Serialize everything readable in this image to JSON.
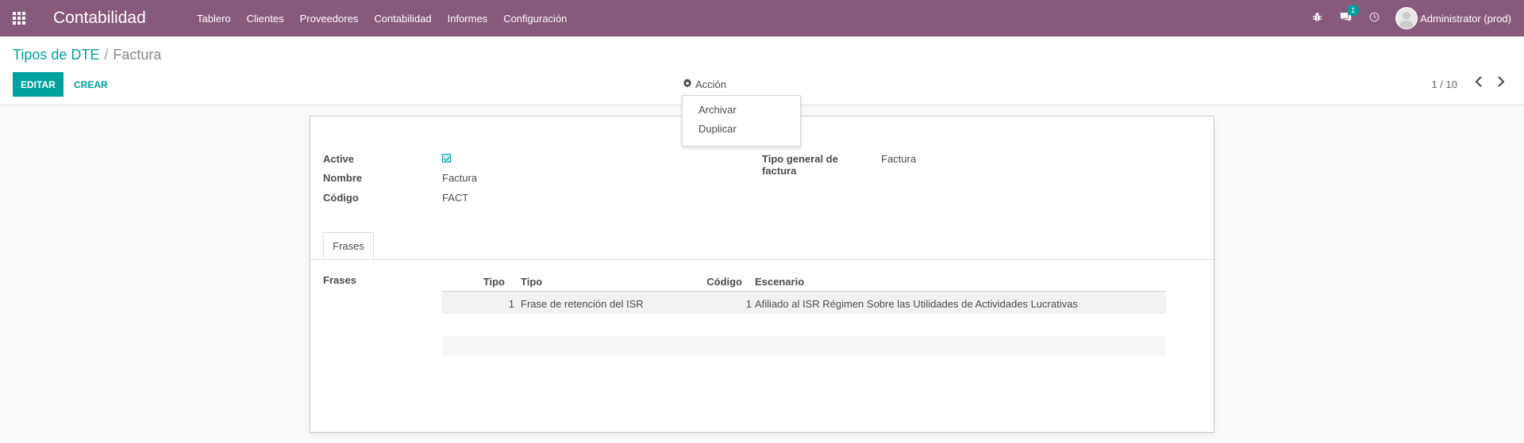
{
  "app": {
    "title": "Contabilidad"
  },
  "menu": [
    {
      "label": "Tablero"
    },
    {
      "label": "Clientes"
    },
    {
      "label": "Proveedores"
    },
    {
      "label": "Contabilidad"
    },
    {
      "label": "Informes"
    },
    {
      "label": "Configuración"
    }
  ],
  "systray": {
    "messages_count": "1",
    "user_name": "Administrator (prod)"
  },
  "breadcrumb": {
    "parent": "Tipos de DTE",
    "separator": "/",
    "current": "Factura"
  },
  "buttons": {
    "edit": "EDITAR",
    "create": "CREAR",
    "action": "Acción"
  },
  "action_menu": {
    "items": [
      {
        "label": "Archivar"
      },
      {
        "label": "Duplicar"
      }
    ]
  },
  "pager": {
    "value": "1 / 10"
  },
  "form": {
    "active_label": "Active",
    "active_checked": true,
    "name_label": "Nombre",
    "name_value": "Factura",
    "code_label": "Código",
    "code_value": "FACT",
    "general_type_label_line1": "Tipo general de",
    "general_type_label_line2": "factura",
    "general_type_value": "Factura"
  },
  "tabs": [
    {
      "label": "Frases",
      "active": true
    }
  ],
  "phrases": {
    "label": "Frases",
    "columns": [
      "Tipo",
      "Tipo",
      "Código",
      "Escenario"
    ],
    "rows": [
      [
        "1",
        "Frase de retención del ISR",
        "1",
        "Afiliado al ISR Régimen Sobre las Utilidades de Actividades Lucrativas"
      ]
    ]
  },
  "colors": {
    "navbar": "#875a7b",
    "accent": "#00a09d"
  }
}
